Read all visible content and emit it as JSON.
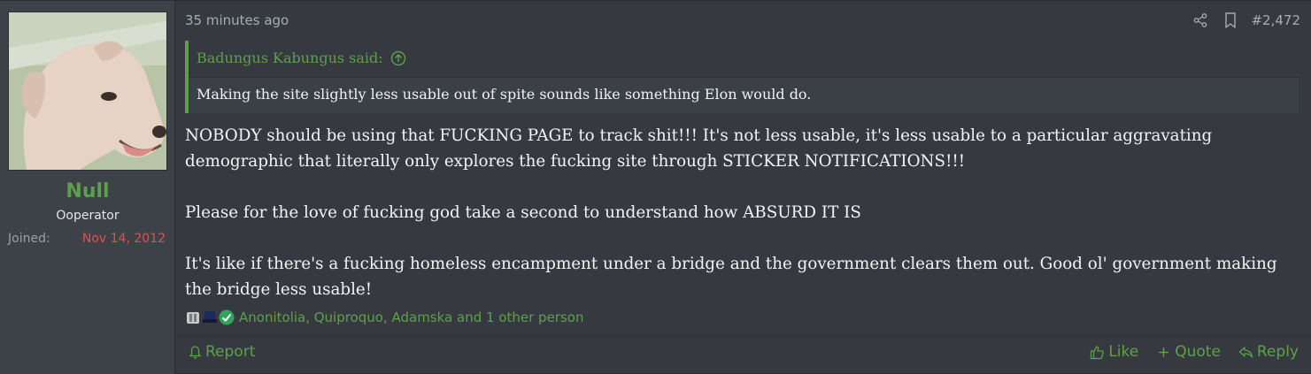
{
  "user": {
    "name": "Null",
    "title": "Ooperator",
    "joined_label": "Joined:",
    "joined_value": "Nov 14, 2012",
    "avatar": "cartoon-dog-avatar"
  },
  "post": {
    "timestamp": "35 minutes ago",
    "number": "#2,472",
    "icons": [
      "share-icon",
      "bookmark-icon"
    ]
  },
  "quote": {
    "author": "Badungus Kabungus said:",
    "text": "Making the site slightly less usable out of spite sounds like something Elon would do."
  },
  "message": {
    "paragraphs": [
      "NOBODY should be using that FUCKING PAGE to track shit!!! It's not less usable, it's less usable to a particular aggravating demographic that literally only explores the fucking site through STICKER NOTIFICATIONS!!!",
      "Please for the love of fucking god take a second to understand how ABSURD IT IS",
      "It's like if there's a fucking homeless encampment under a bridge and the government clears them out. Good ol' government making the bridge less usable!"
    ]
  },
  "reactions": {
    "names": "Anonitolia, Quiproquo, Adamska and 1 other person",
    "icons": [
      "reaction-icon-1",
      "reaction-icon-2",
      "reaction-icon-3"
    ]
  },
  "footer": {
    "report": "Report",
    "like": "Like",
    "quote": "Quote",
    "reply": "Reply"
  },
  "colors": {
    "accent": "#5da04a",
    "joined_date": "#e0534a",
    "background": "#363a40"
  }
}
